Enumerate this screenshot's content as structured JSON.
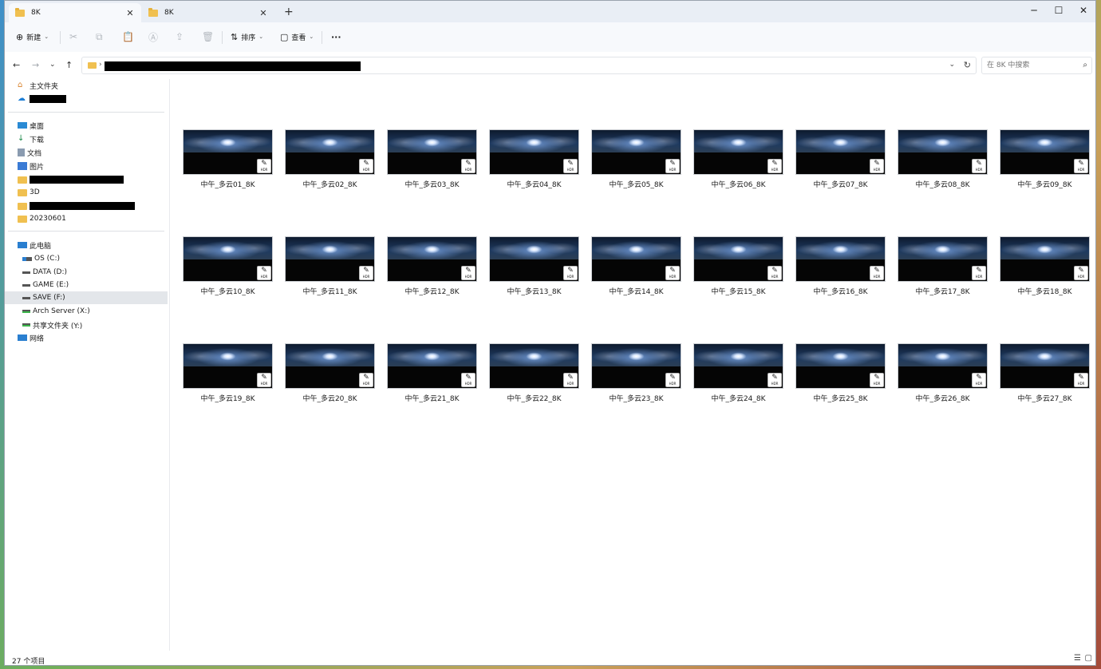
{
  "tabs": [
    {
      "label": "8K"
    },
    {
      "label": "8K"
    }
  ],
  "toolbar": {
    "new_label": "新建",
    "sort_label": "排序",
    "view_label": "查看",
    "more_label": "···"
  },
  "search": {
    "placeholder": "在 8K 中搜索"
  },
  "sidebar": {
    "home": "主文件夹",
    "quick": [
      {
        "label": "桌面",
        "icon": "desktop-icon"
      },
      {
        "label": "下载",
        "icon": "download-icon"
      },
      {
        "label": "文档",
        "icon": "document-icon"
      },
      {
        "label": "图片",
        "icon": "picture-icon"
      }
    ],
    "folder_3d": "3D",
    "folder_date": "20230601",
    "this_pc": "此电脑",
    "drives": [
      {
        "label": "OS (C:)"
      },
      {
        "label": "DATA (D:)"
      },
      {
        "label": "GAME (E:)"
      },
      {
        "label": "SAVE (F:)"
      },
      {
        "label": "Arch Server (X:)"
      },
      {
        "label": "共享文件夹  (Y:)"
      }
    ],
    "network": "网络"
  },
  "files": [
    {
      "name": "中午_多云01_8K"
    },
    {
      "name": "中午_多云02_8K"
    },
    {
      "name": "中午_多云03_8K"
    },
    {
      "name": "中午_多云04_8K"
    },
    {
      "name": "中午_多云05_8K"
    },
    {
      "name": "中午_多云06_8K"
    },
    {
      "name": "中午_多云07_8K"
    },
    {
      "name": "中午_多云08_8K"
    },
    {
      "name": "中午_多云09_8K"
    },
    {
      "name": "中午_多云10_8K"
    },
    {
      "name": "中午_多云11_8K"
    },
    {
      "name": "中午_多云12_8K"
    },
    {
      "name": "中午_多云13_8K"
    },
    {
      "name": "中午_多云14_8K"
    },
    {
      "name": "中午_多云15_8K"
    },
    {
      "name": "中午_多云16_8K"
    },
    {
      "name": "中午_多云17_8K"
    },
    {
      "name": "中午_多云18_8K"
    },
    {
      "name": "中午_多云19_8K"
    },
    {
      "name": "中午_多云20_8K"
    },
    {
      "name": "中午_多云21_8K"
    },
    {
      "name": "中午_多云22_8K"
    },
    {
      "name": "中午_多云23_8K"
    },
    {
      "name": "中午_多云24_8K"
    },
    {
      "name": "中午_多云25_8K"
    },
    {
      "name": "中午_多云26_8K"
    },
    {
      "name": "中午_多云27_8K"
    }
  ],
  "file_badge": "HDR",
  "status": {
    "count": "27 个项目"
  },
  "colors": {
    "folder": "#f0c050",
    "selected": "#e3e6ea",
    "accent": "#0067c0"
  }
}
